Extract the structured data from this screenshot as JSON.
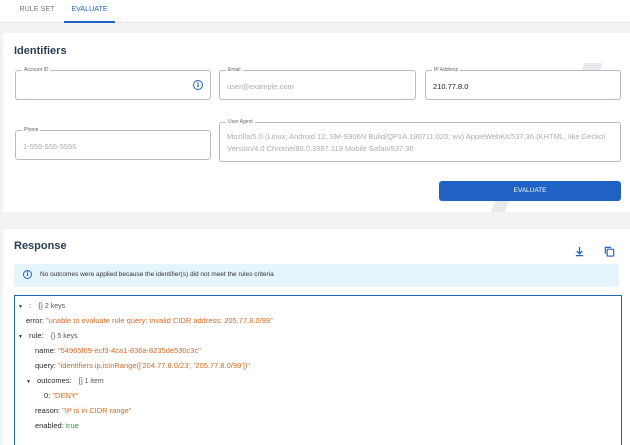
{
  "tabs": [
    {
      "label": "RULE SET"
    },
    {
      "label": "EVALUATE"
    }
  ],
  "identifiers": {
    "title": "Identifiers",
    "account_id": {
      "label": "Account ID",
      "value": ""
    },
    "email": {
      "label": "Email",
      "placeholder": "user@example.com"
    },
    "ip": {
      "label": "IP Address",
      "value": "210.77.8.0"
    },
    "phone": {
      "label": "Phone",
      "placeholder": "1-555-555-5555"
    },
    "user_agent": {
      "label": "User Agent",
      "placeholder": "Mozilla/5.0 (Linux; Android 12; SM-S906N Build/QP1A.190711.020; wv) AppleWebKit/537.36 (KHTML, like Gecko) Version/4.0 Chrome/80.0.3987.119 Mobile Safari/537.36"
    },
    "evaluate_label": "EVALUATE"
  },
  "response": {
    "title": "Response",
    "alert": "No outcomes were applied because the identifier(s) did not meet the rules criteria",
    "json": {
      "root_key": ":",
      "root_meta": "{}  2 keys",
      "error_key": "error:",
      "error_value": "\"unable to evaluate rule query: invalid CIDR address: 205.77.8.0/99\"",
      "rule_key": "rule:",
      "rule_meta": "{}  5 keys",
      "name_key": "name:",
      "name_value": "\"54965f69-ecf3-4ca1-836a-8235de530c3c\"",
      "query_key": "query:",
      "query_value": "\"identifiers.ip.isInRange(['204.77.8.0/23', '205.77.8.0/99'])\"",
      "outcomes_key": "outcomes:",
      "outcomes_meta": "[]  1 item",
      "outcome0_key": "0:",
      "outcome0_value": "\"DENY\"",
      "reason_key": "reason:",
      "reason_value": "\"IP is in CIDR range\"",
      "enabled_key": "enabled:",
      "enabled_value": "true"
    }
  },
  "colors": {
    "accent": "#1f62c4",
    "string": "#d36a25",
    "boolean": "#3a9a3a",
    "alert_bg": "#e6f4fc"
  },
  "icons": {
    "account_info": "info-icon",
    "download": "download-icon",
    "copy": "copy-icon",
    "alert": "info-icon",
    "expand": "caret-down-icon"
  }
}
